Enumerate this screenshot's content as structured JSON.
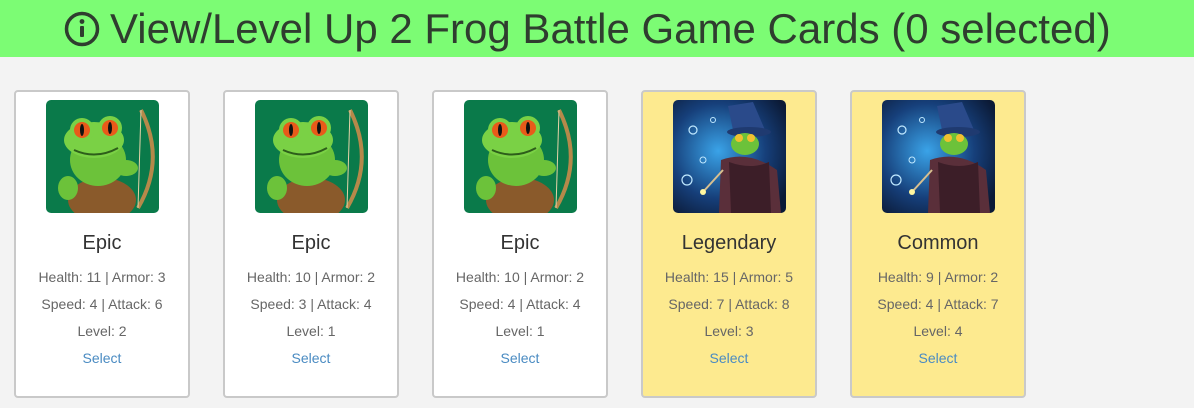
{
  "header": {
    "title": "View/Level Up 2 Frog Battle Game Cards (0 selected)",
    "background": "#7cfc74",
    "icon": "info-icon"
  },
  "cards": [
    {
      "image": "frog-archer-image",
      "rarity": "Epic",
      "health_armor": "Health: 11 | Armor: 3",
      "speed_attack": "Speed: 4 | Attack: 6",
      "level": "Level: 2",
      "select_label": "Select",
      "background": "#ffffff"
    },
    {
      "image": "frog-archer-image",
      "rarity": "Epic",
      "health_armor": "Health: 10 | Armor: 2",
      "speed_attack": "Speed: 3 | Attack: 4",
      "level": "Level: 1",
      "select_label": "Select",
      "background": "#ffffff"
    },
    {
      "image": "frog-archer-image",
      "rarity": "Epic",
      "health_armor": "Health: 10 | Armor: 2",
      "speed_attack": "Speed: 4 | Attack: 4",
      "level": "Level: 1",
      "select_label": "Select",
      "background": "#ffffff"
    },
    {
      "image": "frog-wizard-image",
      "rarity": "Legendary",
      "health_armor": "Health: 15 | Armor: 5",
      "speed_attack": "Speed: 7 | Attack: 8",
      "level": "Level: 3",
      "select_label": "Select",
      "background": "#fdea8f"
    },
    {
      "image": "frog-wizard-image",
      "rarity": "Common",
      "health_armor": "Health: 9 | Armor: 2",
      "speed_attack": "Speed: 4 | Attack: 7",
      "level": "Level: 4",
      "select_label": "Select",
      "background": "#fdea8f"
    }
  ],
  "colors": {
    "link": "#4a8bc2",
    "card_border": "#c9c9c9"
  }
}
